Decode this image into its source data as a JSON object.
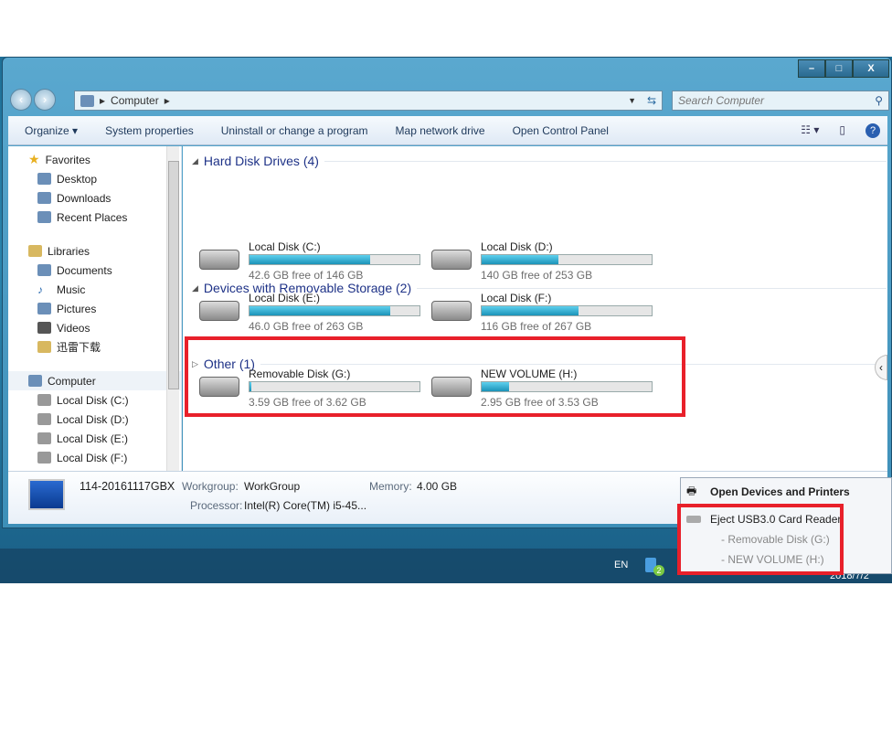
{
  "window": {
    "controls": [
      "minimize",
      "maximize",
      "close"
    ],
    "close_label": "X"
  },
  "address": {
    "path": "Computer",
    "search_placeholder": "Search Computer"
  },
  "toolbar": {
    "organize": "Organize ▾",
    "system_properties": "System properties",
    "uninstall": "Uninstall or change a program",
    "map_drive": "Map network drive",
    "control_panel": "Open Control Panel"
  },
  "sidebar": {
    "favorites": "Favorites",
    "fav_items": [
      "Desktop",
      "Downloads",
      "Recent Places"
    ],
    "libraries": "Libraries",
    "lib_items": [
      "Documents",
      "Music",
      "Pictures",
      "Videos",
      "迅雷下载"
    ],
    "computer": "Computer",
    "comp_items": [
      "Local Disk (C:)",
      "Local Disk (D:)",
      "Local Disk (E:)",
      "Local Disk (F:)"
    ]
  },
  "groups": {
    "hdd": "Hard Disk Drives (4)",
    "removable": "Devices with Removable Storage (2)",
    "other": "Other (1)"
  },
  "drives": [
    {
      "name": "Local Disk (C:)",
      "free": "42.6 GB free of 146 GB",
      "used_pct": 71
    },
    {
      "name": "Local Disk (D:)",
      "free": "140 GB free of 253 GB",
      "used_pct": 45
    },
    {
      "name": "Local Disk (E:)",
      "free": "46.0 GB free of 263 GB",
      "used_pct": 83
    },
    {
      "name": "Local Disk (F:)",
      "free": "116 GB free of 267 GB",
      "used_pct": 57
    },
    {
      "name": "Removable Disk (G:)",
      "free": "3.59 GB free of 3.62 GB",
      "used_pct": 1
    },
    {
      "name": "NEW VOLUME (H:)",
      "free": "2.95 GB free of 3.53 GB",
      "used_pct": 16
    }
  ],
  "details": {
    "name": "114-20161117GBX",
    "workgroup_label": "Workgroup:",
    "workgroup": "WorkGroup",
    "memory_label": "Memory:",
    "memory": "4.00 GB",
    "processor_label": "Processor:",
    "processor": "Intel(R) Core(TM) i5-45..."
  },
  "popup": {
    "open_devices": "Open Devices and Printers",
    "eject": "Eject USB3.0 Card Reader",
    "sub1": "-   Removable Disk (G:)",
    "sub2": "-   NEW VOLUME (H:)"
  },
  "taskbar": {
    "lang": "EN",
    "usb_badge": "2",
    "date": "2018/7/2"
  },
  "colors": {
    "highlight": "#e8202a",
    "bar_fill": "#1b93b8",
    "group_heading": "#1e3287"
  }
}
